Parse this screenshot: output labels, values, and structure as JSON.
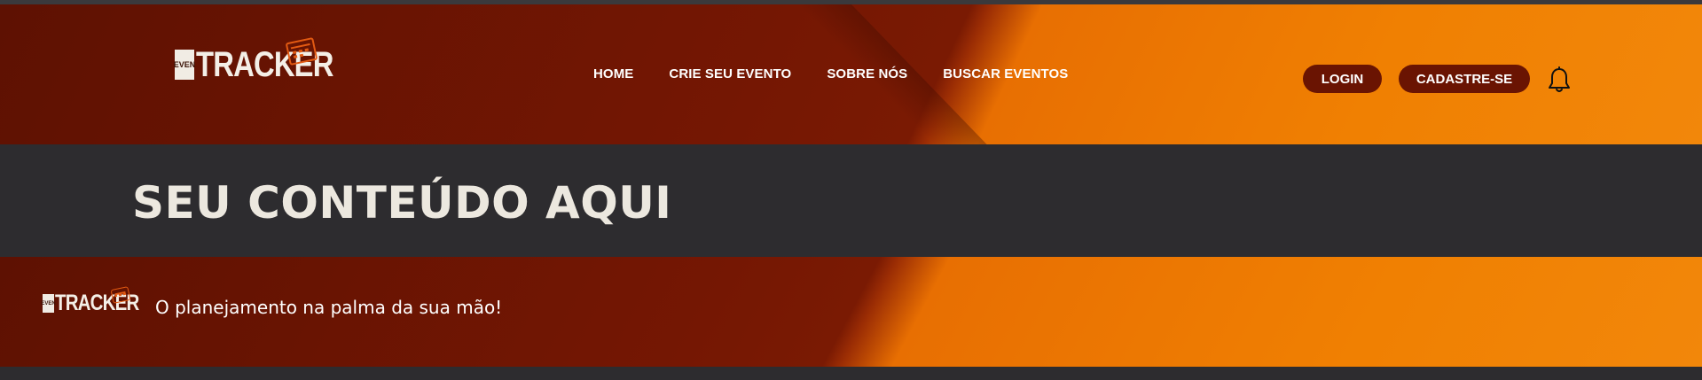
{
  "header": {
    "logo": {
      "ev_text": "EVEN",
      "word": "TRACKER"
    },
    "nav": [
      "HOME",
      "CRIE SEU EVENTO",
      "SOBRE NÓS",
      "BUSCAR EVENTOS"
    ],
    "login_label": "LOGIN",
    "signup_label": "CADASTRE-SE",
    "notification_icon": "bell-icon"
  },
  "main": {
    "title": "SEU CONTEÚDO AQUI"
  },
  "footer": {
    "logo": {
      "ev_text": "EVEN",
      "word": "TRACKER"
    },
    "tagline": "O planejamento na palma da sua mão!"
  },
  "colors": {
    "dark_red": "#751703",
    "orange": "#f08002",
    "pill_bg": "#6a1402",
    "page_bg": "#2d2c2f",
    "title_text": "#ece8df"
  }
}
